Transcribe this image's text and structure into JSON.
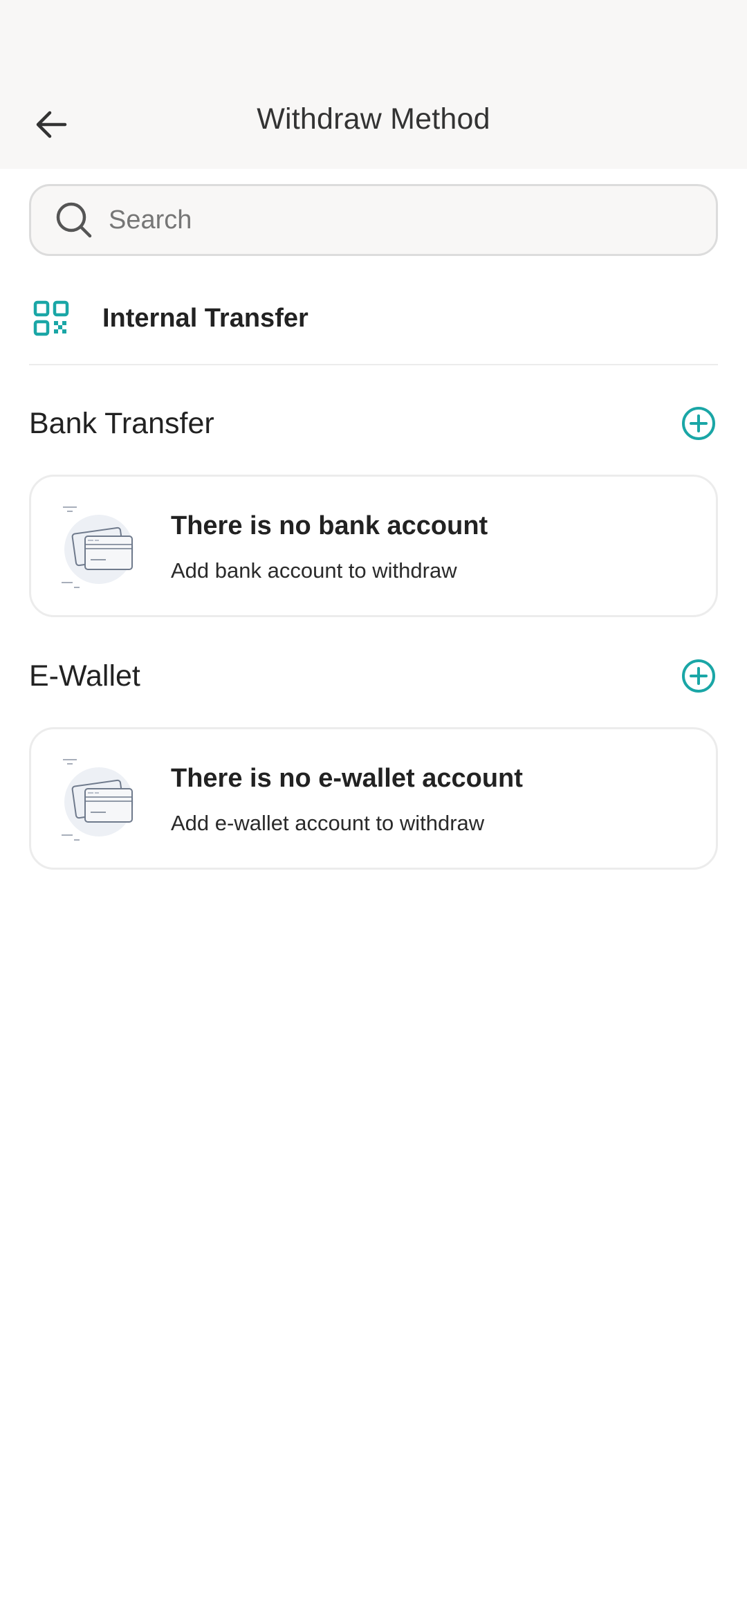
{
  "header": {
    "title": "Withdraw Method",
    "back_icon": "arrow-left-icon"
  },
  "search": {
    "placeholder": "Search",
    "value": "",
    "icon": "search-icon"
  },
  "internal_transfer": {
    "label": "Internal Transfer",
    "icon": "qr-code-icon"
  },
  "sections": {
    "bank": {
      "title": "Bank Transfer",
      "add_icon": "add-circle-icon",
      "empty_title": "There is no bank account",
      "empty_subtitle": "Add bank account to withdraw"
    },
    "ewallet": {
      "title": "E-Wallet",
      "add_icon": "add-circle-icon",
      "empty_title": "There is no e-wallet account",
      "empty_subtitle": "Add e-wallet account to withdraw"
    }
  },
  "colors": {
    "accent": "#1aa6a6",
    "header_bg": "#f8f7f6",
    "card_border": "#ececec"
  }
}
